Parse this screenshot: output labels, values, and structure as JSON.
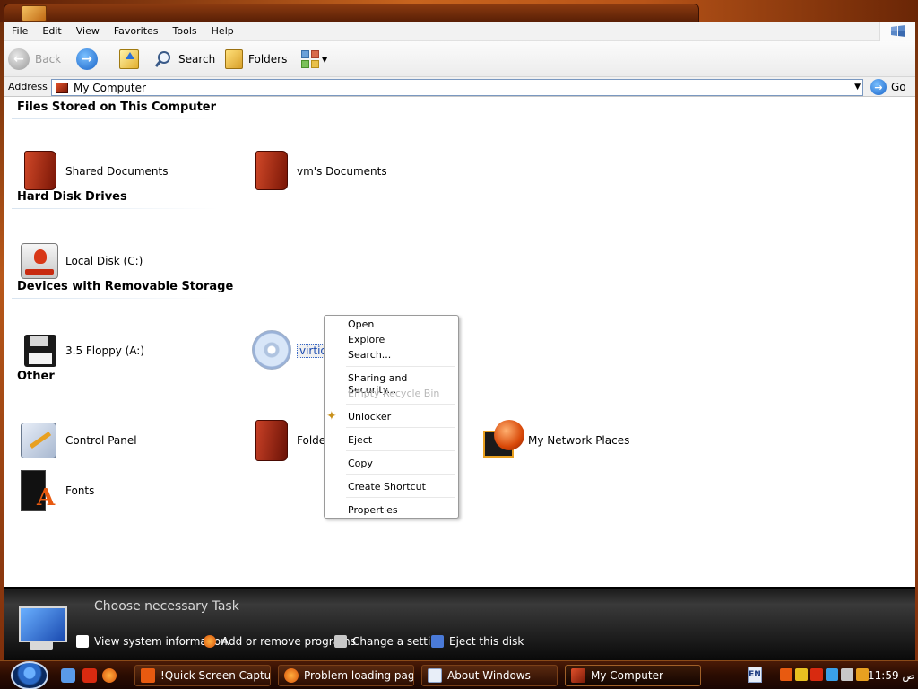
{
  "menu": [
    "File",
    "Edit",
    "View",
    "Favorites",
    "Tools",
    "Help"
  ],
  "toolbar": {
    "back": "Back",
    "search": "Search",
    "folders": "Folders"
  },
  "address": {
    "label": "Address",
    "value": "My Computer",
    "go": "Go"
  },
  "groups": {
    "files": "Files Stored on This Computer",
    "hdd": "Hard Disk Drives",
    "removable": "Devices with Removable Storage",
    "other": "Other"
  },
  "items": {
    "shared_docs": "Shared Documents",
    "vm_docs": "vm's Documents",
    "local_disk": "Local Disk (C:)",
    "floppy": "3.5 Floppy (A:)",
    "cd": "virtio-",
    "control_panel": "Control Panel",
    "folder": "Folder",
    "network": "My Network Places",
    "fonts": "Fonts"
  },
  "context_menu": {
    "open": "Open",
    "explore": "Explore",
    "search": "Search...",
    "sharing": "Sharing and Security...",
    "empty_bin": "Empty Recycle Bin",
    "unlocker": "Unlocker",
    "eject": "Eject",
    "copy": "Copy",
    "shortcut": "Create Shortcut",
    "properties": "Properties"
  },
  "task_panel": {
    "title": "Choose necessary Task",
    "tasks": [
      "View system information",
      "Add or remove programs",
      "Change a setting",
      "Eject this disk"
    ]
  },
  "taskbar": {
    "buttons": [
      "!Quick Screen Capture",
      "Problem loading page ...",
      "About Windows",
      "My Computer"
    ],
    "lang": "EN",
    "clock": "11:59 ص"
  },
  "colors": {
    "accent_red": "#c84026",
    "taskbar": "#2a0c02",
    "selection": "#1a4ab0"
  }
}
